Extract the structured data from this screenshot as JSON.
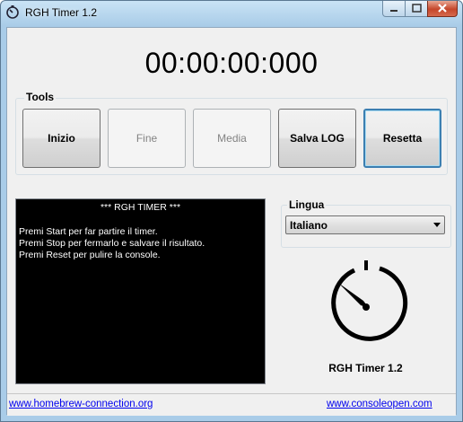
{
  "window": {
    "title": "RGH Timer 1.2"
  },
  "timer": {
    "display": "00:00:00:000"
  },
  "tools": {
    "label": "Tools",
    "buttons": [
      {
        "label": "Inizio",
        "enabled": true
      },
      {
        "label": "Fine",
        "enabled": false
      },
      {
        "label": "Media",
        "enabled": false
      },
      {
        "label": "Salva LOG",
        "enabled": true
      },
      {
        "label": "Resetta",
        "enabled": true,
        "focused": true
      }
    ]
  },
  "console": {
    "title": "*** RGH TIMER ***",
    "lines": [
      "Premi Start per far partire il timer.",
      "Premi Stop per fermarlo e salvare il risultato.",
      "Premi Reset per pulire la console."
    ]
  },
  "language": {
    "label": "Lingua",
    "selected": "Italiano"
  },
  "app": {
    "name": "RGH Timer 1.2",
    "icon": "stopwatch-icon"
  },
  "footer": {
    "left_link": "www.homebrew-connection.org",
    "right_link": "www.consoleopen.com"
  },
  "colors": {
    "accent": "#3c7fb1",
    "link": "#0000ee",
    "console_bg": "#000000"
  }
}
